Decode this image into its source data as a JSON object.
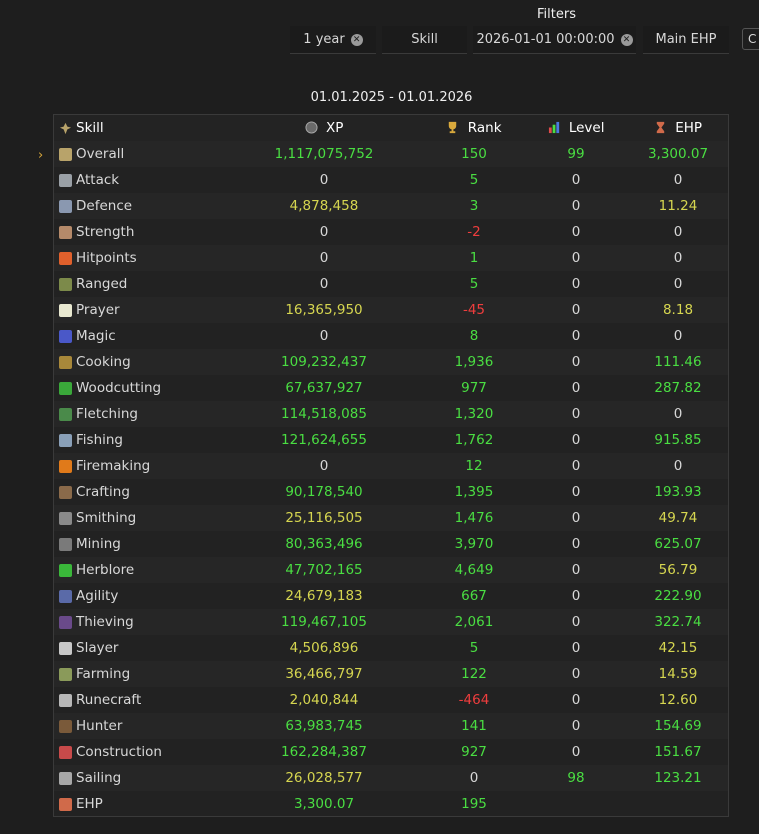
{
  "filters": {
    "title": "Filters",
    "period": "1 year",
    "metric": "Skill",
    "date": "2026-01-01 00:00:00",
    "mode": "Main EHP",
    "cut_button": "C"
  },
  "range": "01.01.2025 - 01.01.2026",
  "headers": {
    "skill": "Skill",
    "xp": "XP",
    "rank": "Rank",
    "level": "Level",
    "ehp": "EHP"
  },
  "colors": {
    "green": "#4ade42",
    "yellow": "#d6d650",
    "red": "#ef3d3d",
    "neutral": "#d8d8d8",
    "selector": "#d9a93c"
  },
  "rows": [
    {
      "skill": "Overall",
      "icon": "overall-icon",
      "color": "#b8a36a",
      "xp": "1,117,075,752",
      "xp_c": "g",
      "rank": "150",
      "rank_c": "g",
      "level": "99",
      "level_c": "g",
      "ehp": "3,300.07",
      "ehp_c": "g"
    },
    {
      "skill": "Attack",
      "icon": "attack-icon",
      "color": "#9aa0a6",
      "xp": "0",
      "xp_c": "w",
      "rank": "5",
      "rank_c": "g",
      "level": "0",
      "level_c": "w",
      "ehp": "0",
      "ehp_c": "w"
    },
    {
      "skill": "Defence",
      "icon": "defence-icon",
      "color": "#8a98b0",
      "xp": "4,878,458",
      "xp_c": "y",
      "rank": "3",
      "rank_c": "g",
      "level": "0",
      "level_c": "w",
      "ehp": "11.24",
      "ehp_c": "y"
    },
    {
      "skill": "Strength",
      "icon": "strength-icon",
      "color": "#b58a6a",
      "xp": "0",
      "xp_c": "w",
      "rank": "-2",
      "rank_c": "r",
      "level": "0",
      "level_c": "w",
      "ehp": "0",
      "ehp_c": "w"
    },
    {
      "skill": "Hitpoints",
      "icon": "hitpoints-icon",
      "color": "#e0602c",
      "xp": "0",
      "xp_c": "w",
      "rank": "1",
      "rank_c": "g",
      "level": "0",
      "level_c": "w",
      "ehp": "0",
      "ehp_c": "w"
    },
    {
      "skill": "Ranged",
      "icon": "ranged-icon",
      "color": "#7c8a4a",
      "xp": "0",
      "xp_c": "w",
      "rank": "5",
      "rank_c": "g",
      "level": "0",
      "level_c": "w",
      "ehp": "0",
      "ehp_c": "w"
    },
    {
      "skill": "Prayer",
      "icon": "prayer-icon",
      "color": "#e8e8d0",
      "xp": "16,365,950",
      "xp_c": "y",
      "rank": "-45",
      "rank_c": "r",
      "level": "0",
      "level_c": "w",
      "ehp": "8.18",
      "ehp_c": "y"
    },
    {
      "skill": "Magic",
      "icon": "magic-icon",
      "color": "#4a58c8",
      "xp": "0",
      "xp_c": "w",
      "rank": "8",
      "rank_c": "g",
      "level": "0",
      "level_c": "w",
      "ehp": "0",
      "ehp_c": "w"
    },
    {
      "skill": "Cooking",
      "icon": "cooking-icon",
      "color": "#a8883a",
      "xp": "109,232,437",
      "xp_c": "g",
      "rank": "1,936",
      "rank_c": "g",
      "level": "0",
      "level_c": "w",
      "ehp": "111.46",
      "ehp_c": "g"
    },
    {
      "skill": "Woodcutting",
      "icon": "woodcutting-icon",
      "color": "#3aa83a",
      "xp": "67,637,927",
      "xp_c": "g",
      "rank": "977",
      "rank_c": "g",
      "level": "0",
      "level_c": "w",
      "ehp": "287.82",
      "ehp_c": "g"
    },
    {
      "skill": "Fletching",
      "icon": "fletching-icon",
      "color": "#4a8a4a",
      "xp": "114,518,085",
      "xp_c": "g",
      "rank": "1,320",
      "rank_c": "g",
      "level": "0",
      "level_c": "w",
      "ehp": "0",
      "ehp_c": "w"
    },
    {
      "skill": "Fishing",
      "icon": "fishing-icon",
      "color": "#8aa0b8",
      "xp": "121,624,655",
      "xp_c": "g",
      "rank": "1,762",
      "rank_c": "g",
      "level": "0",
      "level_c": "w",
      "ehp": "915.85",
      "ehp_c": "g"
    },
    {
      "skill": "Firemaking",
      "icon": "firemaking-icon",
      "color": "#e07a1a",
      "xp": "0",
      "xp_c": "w",
      "rank": "12",
      "rank_c": "g",
      "level": "0",
      "level_c": "w",
      "ehp": "0",
      "ehp_c": "w"
    },
    {
      "skill": "Crafting",
      "icon": "crafting-icon",
      "color": "#8a6a4a",
      "xp": "90,178,540",
      "xp_c": "g",
      "rank": "1,395",
      "rank_c": "g",
      "level": "0",
      "level_c": "w",
      "ehp": "193.93",
      "ehp_c": "g"
    },
    {
      "skill": "Smithing",
      "icon": "smithing-icon",
      "color": "#8a8a8a",
      "xp": "25,116,505",
      "xp_c": "y",
      "rank": "1,476",
      "rank_c": "g",
      "level": "0",
      "level_c": "w",
      "ehp": "49.74",
      "ehp_c": "y"
    },
    {
      "skill": "Mining",
      "icon": "mining-icon",
      "color": "#7a7a7a",
      "xp": "80,363,496",
      "xp_c": "g",
      "rank": "3,970",
      "rank_c": "g",
      "level": "0",
      "level_c": "w",
      "ehp": "625.07",
      "ehp_c": "g"
    },
    {
      "skill": "Herblore",
      "icon": "herblore-icon",
      "color": "#3ab83a",
      "xp": "47,702,165",
      "xp_c": "g",
      "rank": "4,649",
      "rank_c": "g",
      "level": "0",
      "level_c": "w",
      "ehp": "56.79",
      "ehp_c": "y"
    },
    {
      "skill": "Agility",
      "icon": "agility-icon",
      "color": "#5a6aa8",
      "xp": "24,679,183",
      "xp_c": "y",
      "rank": "667",
      "rank_c": "g",
      "level": "0",
      "level_c": "w",
      "ehp": "222.90",
      "ehp_c": "g"
    },
    {
      "skill": "Thieving",
      "icon": "thieving-icon",
      "color": "#6a4a8a",
      "xp": "119,467,105",
      "xp_c": "g",
      "rank": "2,061",
      "rank_c": "g",
      "level": "0",
      "level_c": "w",
      "ehp": "322.74",
      "ehp_c": "g"
    },
    {
      "skill": "Slayer",
      "icon": "slayer-icon",
      "color": "#c8c8c8",
      "xp": "4,506,896",
      "xp_c": "y",
      "rank": "5",
      "rank_c": "g",
      "level": "0",
      "level_c": "w",
      "ehp": "42.15",
      "ehp_c": "y"
    },
    {
      "skill": "Farming",
      "icon": "farming-icon",
      "color": "#8a9a5a",
      "xp": "36,466,797",
      "xp_c": "y",
      "rank": "122",
      "rank_c": "g",
      "level": "0",
      "level_c": "w",
      "ehp": "14.59",
      "ehp_c": "y"
    },
    {
      "skill": "Runecraft",
      "icon": "runecraft-icon",
      "color": "#b8b8b8",
      "xp": "2,040,844",
      "xp_c": "y",
      "rank": "-464",
      "rank_c": "r",
      "level": "0",
      "level_c": "w",
      "ehp": "12.60",
      "ehp_c": "y"
    },
    {
      "skill": "Hunter",
      "icon": "hunter-icon",
      "color": "#7a5a3a",
      "xp": "63,983,745",
      "xp_c": "g",
      "rank": "141",
      "rank_c": "g",
      "level": "0",
      "level_c": "w",
      "ehp": "154.69",
      "ehp_c": "g"
    },
    {
      "skill": "Construction",
      "icon": "construction-icon",
      "color": "#c84a4a",
      "xp": "162,284,387",
      "xp_c": "g",
      "rank": "927",
      "rank_c": "g",
      "level": "0",
      "level_c": "w",
      "ehp": "151.67",
      "ehp_c": "g"
    },
    {
      "skill": "Sailing",
      "icon": "sailing-icon",
      "color": "#a8a8a8",
      "xp": "26,028,577",
      "xp_c": "y",
      "rank": "0",
      "rank_c": "w",
      "level": "98",
      "level_c": "g",
      "ehp": "123.21",
      "ehp_c": "g"
    },
    {
      "skill": "EHP",
      "icon": "hourglass-icon",
      "color": "#d06a4a",
      "xp": "3,300.07",
      "xp_c": "g",
      "rank": "195",
      "rank_c": "g",
      "level": "",
      "level_c": "w",
      "ehp": "",
      "ehp_c": "w"
    }
  ]
}
